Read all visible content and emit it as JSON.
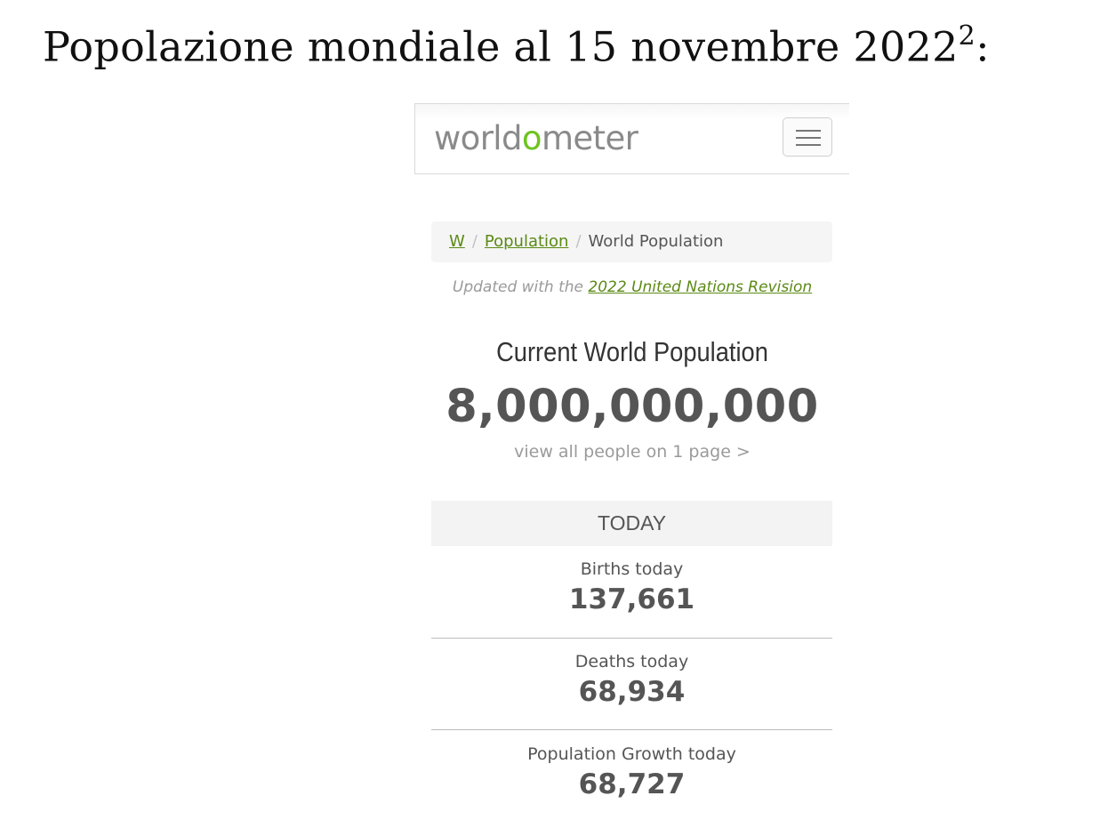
{
  "slide": {
    "title": "Popolazione mondiale al 15 novembre 2022",
    "footnote": "2",
    "colon": ":"
  },
  "site": {
    "logo_prefix": "worldometer_prefix",
    "logo_parts": [
      "world",
      "o",
      "meter"
    ],
    "menu_icon": "hamburger-menu-icon"
  },
  "breadcrumb": {
    "home": "W",
    "population": "Population",
    "current": "World Population",
    "separator": "/"
  },
  "updated": {
    "text": "Updated with the ",
    "link": "2022 United Nations Revision"
  },
  "main": {
    "heading": "Current World Population",
    "count": "8,000,000,000",
    "view_all": "view all people on 1 page >"
  },
  "today": {
    "heading": "TODAY",
    "stats": [
      {
        "label": "Births today",
        "value": "137,661"
      },
      {
        "label": "Deaths today",
        "value": "68,934"
      },
      {
        "label": "Population Growth today",
        "value": "68,727"
      }
    ]
  },
  "colors": {
    "accent_green": "#5b8a15",
    "logo_green": "#6ec320",
    "logo_gray": "#8a8a8a"
  }
}
